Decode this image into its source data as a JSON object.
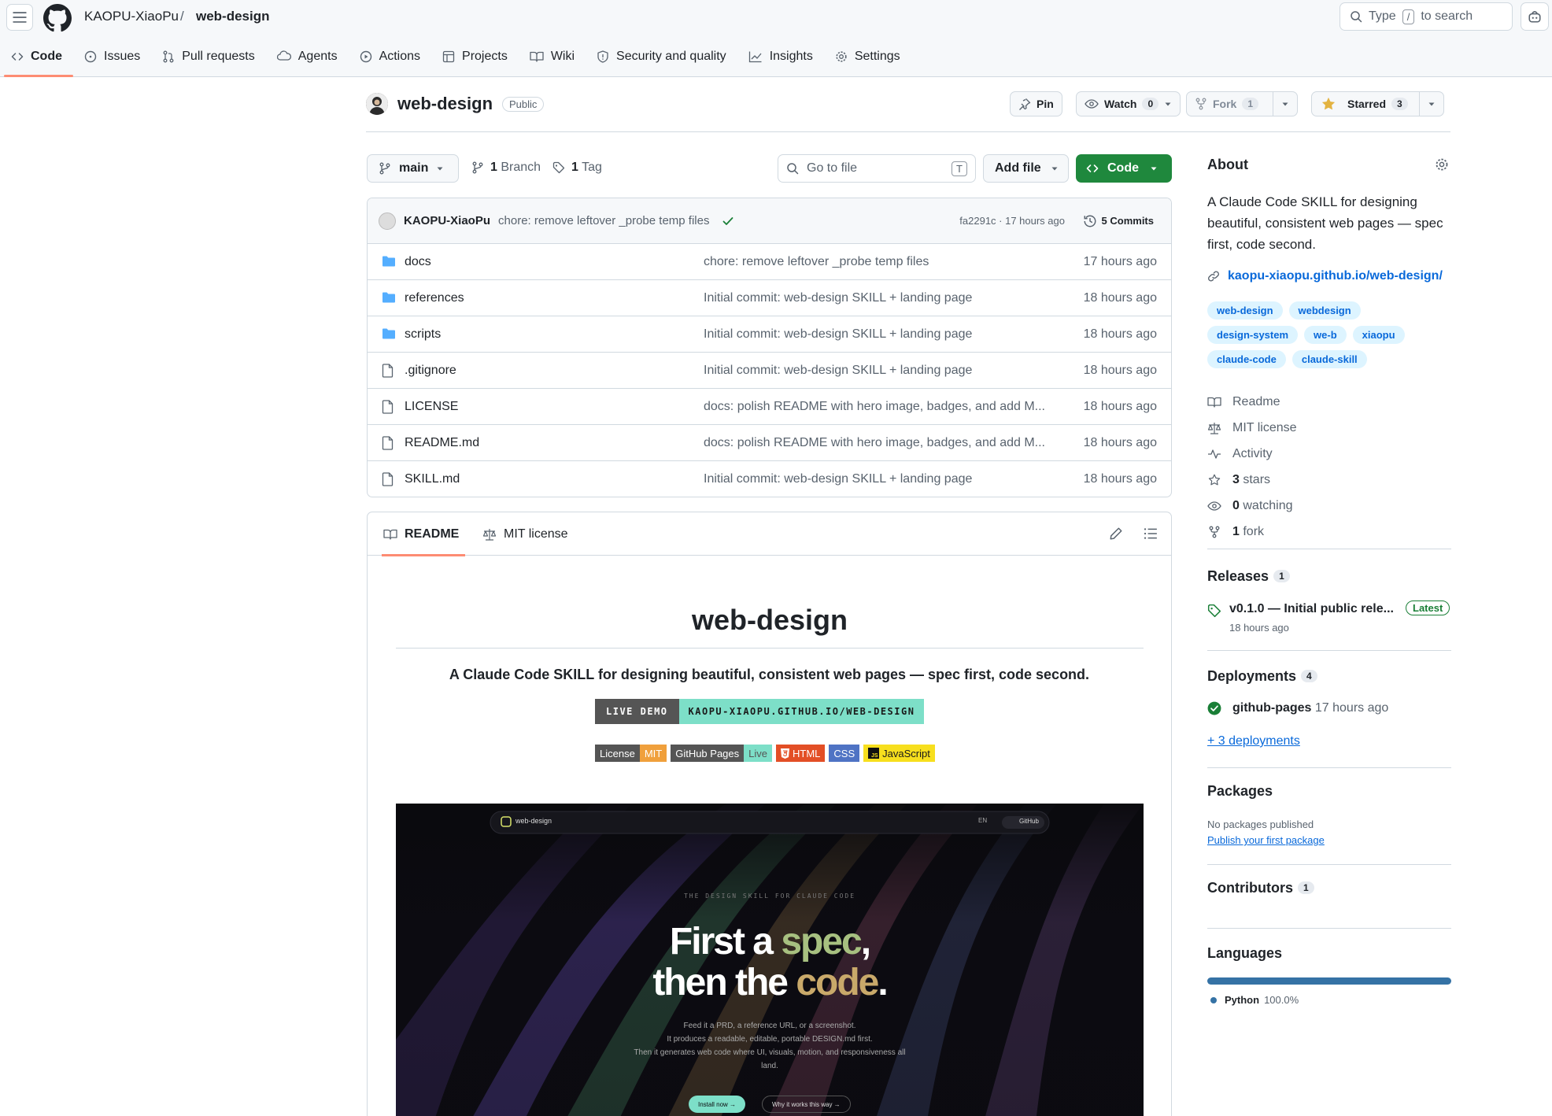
{
  "breadcrumb": {
    "owner": "KAOPU-XiaoPu",
    "sep": "/",
    "repo": "web-design"
  },
  "search": {
    "pre": "Type",
    "key": "/",
    "post": "to search"
  },
  "nav": [
    {
      "label": "Code",
      "icon": "code-icon"
    },
    {
      "label": "Issues",
      "icon": "issue-icon"
    },
    {
      "label": "Pull requests",
      "icon": "pull-request-icon"
    },
    {
      "label": "Agents",
      "icon": "agents-icon"
    },
    {
      "label": "Actions",
      "icon": "play-icon"
    },
    {
      "label": "Projects",
      "icon": "table-icon"
    },
    {
      "label": "Wiki",
      "icon": "book-icon"
    },
    {
      "label": "Security and quality",
      "icon": "shield-icon"
    },
    {
      "label": "Insights",
      "icon": "graph-icon"
    },
    {
      "label": "Settings",
      "icon": "gear-icon"
    }
  ],
  "repo": {
    "name": "web-design",
    "visibility": "Public",
    "pin": "Pin",
    "watch": "Watch",
    "watch_count": "0",
    "fork": "Fork",
    "fork_count": "1",
    "star": "Starred",
    "star_count": "3"
  },
  "browser": {
    "branch": "main",
    "branch_count": "1",
    "branch_label": "Branch",
    "tag_count": "1",
    "tag_label": "Tag",
    "goto": "Go to file",
    "goto_key": "T",
    "addfile": "Add file",
    "code": "Code"
  },
  "commit": {
    "author": "KAOPU-XiaoPu",
    "message": "chore: remove leftover _probe temp files",
    "sha_time": "fa2291c · 17 hours ago",
    "commits": "5 Commits"
  },
  "files": [
    {
      "name": "docs",
      "type": "dir",
      "msg": "chore: remove leftover _probe temp files",
      "time": "17 hours ago"
    },
    {
      "name": "references",
      "type": "dir",
      "msg": "Initial commit: web-design SKILL + landing page",
      "time": "18 hours ago"
    },
    {
      "name": "scripts",
      "type": "dir",
      "msg": "Initial commit: web-design SKILL + landing page",
      "time": "18 hours ago"
    },
    {
      "name": ".gitignore",
      "type": "file",
      "msg": "Initial commit: web-design SKILL + landing page",
      "time": "18 hours ago"
    },
    {
      "name": "LICENSE",
      "type": "file",
      "msg": "docs: polish README with hero image, badges, and add M...",
      "time": "18 hours ago"
    },
    {
      "name": "README.md",
      "type": "file",
      "msg": "docs: polish README with hero image, badges, and add M...",
      "time": "18 hours ago"
    },
    {
      "name": "SKILL.md",
      "type": "file",
      "msg": "Initial commit: web-design SKILL + landing page",
      "time": "18 hours ago"
    }
  ],
  "readme": {
    "tab_readme": "README",
    "tab_license": "MIT license",
    "title": "web-design",
    "subtitle": "A Claude Code SKILL for designing beautiful, consistent web pages — spec first, code second.",
    "demo_left": "LIVE DEMO",
    "demo_right": "KAOPU-XIAOPU.GITHUB.IO/WEB-DESIGN",
    "badges": [
      {
        "l": "License",
        "r": "MIT",
        "lc": "#555555",
        "rc": "#f0a03c"
      },
      {
        "l": "GitHub Pages",
        "r": "Live",
        "lc": "#555555",
        "rc": "#7ddfc8"
      },
      {
        "l": "HTML",
        "r": "",
        "lc": "#e34f26",
        "rc": "#e34f26"
      },
      {
        "l": "CSS",
        "r": "",
        "lc": "#4f73c4",
        "rc": "#4f73c4"
      },
      {
        "l": "JavaScript",
        "r": "",
        "lc": "#f7df1e",
        "rc": "#f7df1e"
      }
    ],
    "hero": {
      "brand": "web-design",
      "lang": "EN",
      "github": "GitHub",
      "eyebrow": "THE DESIGN SKILL FOR CLAUDE CODE",
      "h1_a": "First a ",
      "h1_b": "spec",
      "h1_c": ",",
      "h2_a": "then the ",
      "h2_b": "code",
      "h2_c": ".",
      "p1": "Feed it a PRD, a reference URL, or a screenshot.",
      "p2": "It produces a readable, editable, portable DESIGN.md first.",
      "p3": "Then it generates web code where UI, visuals, motion, and responsiveness all",
      "p4": "land.",
      "cta1": "Install now →",
      "cta2": "Why it works this way →"
    }
  },
  "about": {
    "heading": "About",
    "desc": "A Claude Code SKILL for designing beautiful, consistent web pages — spec first, code second.",
    "link": "kaopu-xiaopu.github.io/web-design/",
    "topics": [
      "web-design",
      "webdesign",
      "design-system",
      "we-b",
      "xiaopu",
      "claude-code",
      "claude-skill"
    ],
    "readme": "Readme",
    "license": "MIT license",
    "activity": "Activity",
    "stars_n": "3",
    "stars": "stars",
    "watching_n": "0",
    "watching": "watching",
    "fork_n": "1",
    "fork": "fork"
  },
  "releases": {
    "heading": "Releases",
    "count": "1",
    "name": "v0.1.0 — Initial public rele...",
    "latest": "Latest",
    "time": "18 hours ago"
  },
  "deployments": {
    "heading": "Deployments",
    "count": "4",
    "name": "github-pages",
    "time": "17 hours ago",
    "more": "+ 3 deployments"
  },
  "packages": {
    "heading": "Packages",
    "none": "No packages published",
    "link": "Publish your first package"
  },
  "contributors": {
    "heading": "Contributors",
    "count": "1"
  },
  "languages": {
    "heading": "Languages",
    "name": "Python",
    "pct": "100.0%",
    "color": "#3572a5"
  }
}
